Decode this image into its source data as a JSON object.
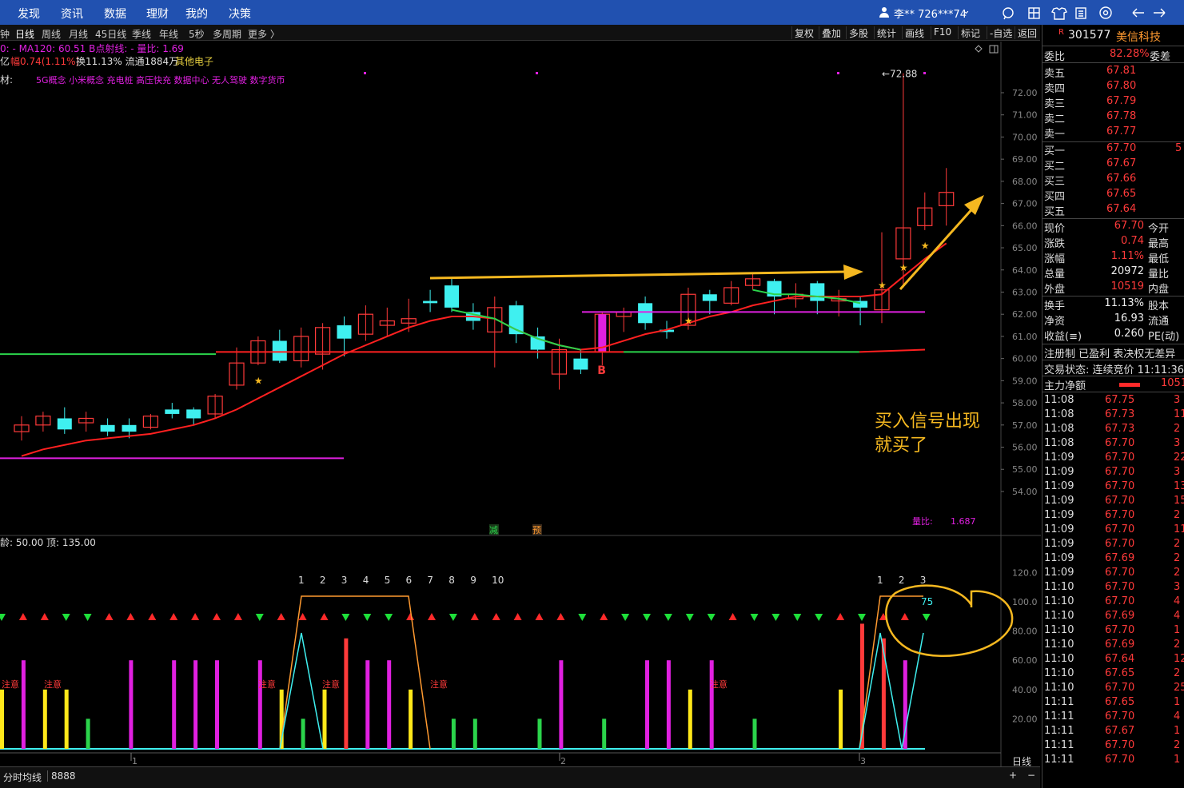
{
  "colors": {
    "up": "#ff3a3a",
    "down": "#3ff0f0",
    "ma_short": "#ff2020",
    "ma_green": "#2bd44b",
    "magenta": "#e020e0",
    "yellow": "#ffe81a",
    "arrow": "#f5b820"
  },
  "topnav": {
    "items": [
      "发现",
      "资讯",
      "数据",
      "理财",
      "我的",
      "决策"
    ],
    "user": "李** 726***74"
  },
  "periodbar": {
    "items": [
      "钟",
      "日线",
      "周线",
      "月线",
      "45日线",
      "季线",
      "年线",
      "5秒",
      "多周期",
      "更多 〉"
    ],
    "active": 1,
    "tools": [
      "复权",
      "叠加",
      "多股",
      "统计",
      "画线",
      "F10",
      "标记",
      "-自选",
      "返回"
    ]
  },
  "info": {
    "line1": "0: - MA120: 60.51  B点射线: -  量比: 1.69",
    "line2_prefix": "亿",
    "line2_change": "幅0.74(1.11%)",
    "line2_rest": "换11.13% 流通1884万",
    "line2_sector": "其他电子",
    "line3_label": "材:",
    "concepts": "5G概念  小米概念  充电桩  高压快充  数据中心  无人驾驶  数字货币"
  },
  "chart_data": {
    "type": "candlestick",
    "y_ticks": [
      "72.00",
      "71.00",
      "70.00",
      "69.00",
      "68.00",
      "67.00",
      "66.00",
      "65.00",
      "64.00",
      "63.00",
      "62.00",
      "61.00",
      "60.00",
      "59.00",
      "58.00",
      "57.00",
      "56.00",
      "55.00",
      "54.00"
    ],
    "ylim": [
      53.2,
      73.2
    ],
    "high_label": "72.88",
    "candles": [
      {
        "o": 56.7,
        "c": 57.0,
        "h": 57.4,
        "l": 56.3
      },
      {
        "o": 57.0,
        "c": 57.4,
        "h": 57.6,
        "l": 56.7
      },
      {
        "o": 57.3,
        "c": 56.8,
        "h": 57.8,
        "l": 56.6
      },
      {
        "o": 57.1,
        "c": 57.3,
        "h": 57.6,
        "l": 56.7
      },
      {
        "o": 57.0,
        "c": 56.7,
        "h": 57.3,
        "l": 56.5
      },
      {
        "o": 57.0,
        "c": 56.7,
        "h": 57.3,
        "l": 56.4
      },
      {
        "o": 56.9,
        "c": 57.4,
        "h": 57.5,
        "l": 56.8
      },
      {
        "o": 57.7,
        "c": 57.5,
        "h": 58.0,
        "l": 57.3
      },
      {
        "o": 57.7,
        "c": 57.3,
        "h": 57.8,
        "l": 57.0
      },
      {
        "o": 57.5,
        "c": 58.3,
        "h": 58.4,
        "l": 57.3
      },
      {
        "o": 58.8,
        "c": 59.8,
        "h": 60.5,
        "l": 58.6
      },
      {
        "o": 59.8,
        "c": 60.8,
        "h": 61.0,
        "l": 59.7
      },
      {
        "o": 60.8,
        "c": 59.9,
        "h": 61.3,
        "l": 59.8
      },
      {
        "o": 59.9,
        "c": 61.0,
        "h": 61.4,
        "l": 59.6
      },
      {
        "o": 60.2,
        "c": 61.4,
        "h": 61.6,
        "l": 59.5
      },
      {
        "o": 61.5,
        "c": 60.9,
        "h": 61.9,
        "l": 60.1
      },
      {
        "o": 61.1,
        "c": 62.0,
        "h": 62.4,
        "l": 60.8
      },
      {
        "o": 61.5,
        "c": 61.7,
        "h": 62.3,
        "l": 61.0
      },
      {
        "o": 61.6,
        "c": 61.8,
        "h": 62.7,
        "l": 61.2
      },
      {
        "o": 62.6,
        "c": 62.5,
        "h": 63.1,
        "l": 62.1
      },
      {
        "o": 63.3,
        "c": 62.3,
        "h": 63.6,
        "l": 62.1
      },
      {
        "o": 62.1,
        "c": 61.7,
        "h": 62.5,
        "l": 61.3
      },
      {
        "o": 61.2,
        "c": 62.3,
        "h": 62.8,
        "l": 59.6
      },
      {
        "o": 62.4,
        "c": 61.1,
        "h": 62.6,
        "l": 60.7
      },
      {
        "o": 61.0,
        "c": 60.4,
        "h": 61.4,
        "l": 60.0
      },
      {
        "o": 59.3,
        "c": 60.4,
        "h": 60.9,
        "l": 58.6
      },
      {
        "o": 60.0,
        "c": 59.5,
        "h": 60.4,
        "l": 59.3
      },
      {
        "o": 60.3,
        "c": 62.0,
        "h": 62.1,
        "l": 59.7
      },
      {
        "o": 61.9,
        "c": 62.1,
        "h": 62.3,
        "l": 61.2
      },
      {
        "o": 62.5,
        "c": 61.6,
        "h": 62.8,
        "l": 61.3
      },
      {
        "o": 61.3,
        "c": 61.2,
        "h": 61.7,
        "l": 60.9
      },
      {
        "o": 61.5,
        "c": 62.9,
        "h": 63.2,
        "l": 61.3
      },
      {
        "o": 62.9,
        "c": 62.6,
        "h": 63.1,
        "l": 62.0
      },
      {
        "o": 62.5,
        "c": 63.2,
        "h": 63.5,
        "l": 62.4
      },
      {
        "o": 63.3,
        "c": 63.6,
        "h": 63.9,
        "l": 63.1
      },
      {
        "o": 63.5,
        "c": 62.8,
        "h": 63.6,
        "l": 62.0
      },
      {
        "o": 62.7,
        "c": 62.9,
        "h": 63.4,
        "l": 62.3
      },
      {
        "o": 63.4,
        "c": 62.6,
        "h": 63.5,
        "l": 62.0
      },
      {
        "o": 62.6,
        "c": 62.7,
        "h": 63.1,
        "l": 61.9
      },
      {
        "o": 62.6,
        "c": 62.3,
        "h": 62.8,
        "l": 61.5
      },
      {
        "o": 62.2,
        "c": 63.1,
        "h": 65.7,
        "l": 61.6
      },
      {
        "o": 64.5,
        "c": 65.9,
        "h": 72.88,
        "l": 63.2
      },
      {
        "o": 66.0,
        "c": 66.8,
        "h": 67.5,
        "l": 65.8
      },
      {
        "o": 66.9,
        "c": 67.5,
        "h": 68.6,
        "l": 66.0
      }
    ],
    "ma_red": [
      55.6,
      55.9,
      56.1,
      56.3,
      56.4,
      56.5,
      56.6,
      56.8,
      57.0,
      57.3,
      57.7,
      58.2,
      58.7,
      59.2,
      59.7,
      60.2,
      60.6,
      61.0,
      61.4,
      61.7,
      61.9,
      61.9,
      61.8,
      61.3,
      60.9,
      60.6,
      60.4,
      60.5,
      60.8,
      61.1,
      61.3,
      61.6,
      61.9,
      62.1,
      62.4,
      62.6,
      62.8,
      62.8,
      62.8,
      62.8,
      62.9,
      63.7,
      64.5,
      65.2
    ],
    "ma_green_segments": [
      [
        57.0,
        63.1,
        37,
        40
      ]
    ],
    "stars": [
      {
        "i": 11,
        "v": 59.0
      },
      {
        "i": 31,
        "v": 61.7
      },
      {
        "i": 40,
        "v": 63.3
      },
      {
        "i": 41,
        "v": 64.1
      },
      {
        "i": 42,
        "v": 65.1
      }
    ],
    "b_signal_index": 27,
    "hline_magenta_left": 55.5,
    "hline_magenta_right": 62.1,
    "annotation_text": [
      "买入信号出现",
      "就买了"
    ],
    "volume_ratio_label": "量比:",
    "volume_ratio": "1.687",
    "markers": [
      "减",
      "预"
    ]
  },
  "indicator": {
    "title": "龄: 50.00 顶: 135.00",
    "y_ticks": [
      "120.0",
      "100.0",
      "80.00",
      "60.00",
      "40.00",
      "20.00"
    ],
    "counts_left": [
      "1",
      "2",
      "3",
      "4",
      "5",
      "6",
      "7",
      "8",
      "9",
      "10"
    ],
    "counts_right": [
      "1",
      "2",
      "3"
    ],
    "value_label": "75",
    "warnings": [
      "注意",
      "注意",
      "注意",
      "注意",
      "注意",
      "注意"
    ],
    "triangles": "gruggruurrrrgrrrgggrrgrrrrrgugggggrggggrgrug",
    "bars": [
      [
        1,
        "y",
        40
      ],
      [
        2,
        "m",
        60
      ],
      [
        3,
        "y",
        40
      ],
      [
        4,
        "y",
        40
      ],
      [
        5,
        "g",
        20
      ],
      [
        7,
        "m",
        60
      ],
      [
        9,
        "m",
        60
      ],
      [
        10,
        "m",
        60
      ],
      [
        11,
        "m",
        60
      ],
      [
        13,
        "m",
        60
      ],
      [
        14,
        "y",
        40
      ],
      [
        15,
        "g",
        20
      ],
      [
        16,
        "y",
        40
      ],
      [
        17,
        "r",
        75
      ],
      [
        18,
        "m",
        60
      ],
      [
        19,
        "m",
        60
      ],
      [
        20,
        "y",
        40
      ],
      [
        22,
        "g",
        20
      ],
      [
        23,
        "g",
        20
      ],
      [
        26,
        "g",
        20
      ],
      [
        27,
        "m",
        60
      ],
      [
        29,
        "g",
        20
      ],
      [
        31,
        "m",
        60
      ],
      [
        32,
        "m",
        60
      ],
      [
        33,
        "y",
        40
      ],
      [
        34,
        "m",
        60
      ],
      [
        36,
        "g",
        20
      ],
      [
        40,
        "y",
        40
      ],
      [
        41,
        "r",
        85
      ],
      [
        42,
        "r",
        75
      ],
      [
        43,
        "m",
        60
      ]
    ],
    "x_labels": [
      "1",
      "2",
      "3"
    ]
  },
  "rightpanel": {
    "stock": {
      "mark": "R",
      "code": "301577",
      "name": "美信科技"
    },
    "weibi": {
      "label": "委比",
      "value": "82.28%",
      "label2": "委差"
    },
    "asks": [
      {
        "l": "卖五",
        "p": "67.81"
      },
      {
        "l": "卖四",
        "p": "67.80"
      },
      {
        "l": "卖三",
        "p": "67.79"
      },
      {
        "l": "卖二",
        "p": "67.78"
      },
      {
        "l": "卖一",
        "p": "67.77"
      }
    ],
    "bids": [
      {
        "l": "买一",
        "p": "67.70",
        "v": "5"
      },
      {
        "l": "买二",
        "p": "67.67",
        "v": ""
      },
      {
        "l": "买三",
        "p": "67.66",
        "v": ""
      },
      {
        "l": "买四",
        "p": "67.65",
        "v": ""
      },
      {
        "l": "买五",
        "p": "67.64",
        "v": ""
      }
    ],
    "stats": [
      {
        "l": "现价",
        "v": "67.70",
        "r": "今开",
        "c": "red"
      },
      {
        "l": "涨跌",
        "v": "0.74",
        "r": "最高",
        "c": "red"
      },
      {
        "l": "涨幅",
        "v": "1.11%",
        "r": "最低",
        "c": "red"
      },
      {
        "l": "总量",
        "v": "20972",
        "r": "量比",
        "c": "wht"
      },
      {
        "l": "外盘",
        "v": "10519",
        "r": "内盘",
        "c": "red"
      }
    ],
    "stats2": [
      {
        "l": "换手",
        "v": "11.13%",
        "r": "股本"
      },
      {
        "l": "净资",
        "v": "16.93",
        "r": "流通"
      },
      {
        "l": "收益(≡)",
        "v": "0.260",
        "r": "PE(动)"
      }
    ],
    "regtext": "注册制 已盈利 表决权无差异",
    "tradestatus": "交易状态: 连续竞价 11:11:36",
    "mainnet": {
      "label": "主力净额",
      "value": "1051"
    },
    "ticks": [
      {
        "t": "11:08",
        "p": "67.75",
        "v": "3"
      },
      {
        "t": "11:08",
        "p": "67.73",
        "v": "11"
      },
      {
        "t": "11:08",
        "p": "67.73",
        "v": "2"
      },
      {
        "t": "11:08",
        "p": "67.70",
        "v": "3"
      },
      {
        "t": "11:09",
        "p": "67.70",
        "v": "22"
      },
      {
        "t": "11:09",
        "p": "67.70",
        "v": "3"
      },
      {
        "t": "11:09",
        "p": "67.70",
        "v": "13"
      },
      {
        "t": "11:09",
        "p": "67.70",
        "v": "15"
      },
      {
        "t": "11:09",
        "p": "67.70",
        "v": "2"
      },
      {
        "t": "11:09",
        "p": "67.70",
        "v": "11"
      },
      {
        "t": "11:09",
        "p": "67.70",
        "v": "2"
      },
      {
        "t": "11:09",
        "p": "67.69",
        "v": "2"
      },
      {
        "t": "11:09",
        "p": "67.70",
        "v": "2"
      },
      {
        "t": "11:10",
        "p": "67.70",
        "v": "3"
      },
      {
        "t": "11:10",
        "p": "67.70",
        "v": "4"
      },
      {
        "t": "11:10",
        "p": "67.69",
        "v": "4"
      },
      {
        "t": "11:10",
        "p": "67.70",
        "v": "1"
      },
      {
        "t": "11:10",
        "p": "67.69",
        "v": "2"
      },
      {
        "t": "11:10",
        "p": "67.64",
        "v": "12"
      },
      {
        "t": "11:10",
        "p": "67.65",
        "v": "2"
      },
      {
        "t": "11:10",
        "p": "67.70",
        "v": "25"
      },
      {
        "t": "11:11",
        "p": "67.65",
        "v": "1"
      },
      {
        "t": "11:11",
        "p": "67.70",
        "v": "4"
      },
      {
        "t": "11:11",
        "p": "67.67",
        "v": "1"
      },
      {
        "t": "11:11",
        "p": "67.70",
        "v": "2"
      },
      {
        "t": "11:11",
        "p": "67.70",
        "v": "1"
      }
    ]
  },
  "bottombar": {
    "label": "分时均线",
    "value": "8888",
    "right": "日线"
  }
}
